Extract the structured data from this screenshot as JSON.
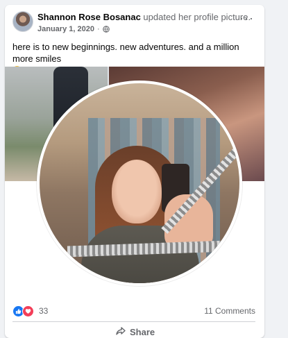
{
  "post": {
    "author": "Shannon Rose Bosanac",
    "action": " updated her profile picture.",
    "date": "January 1, 2020",
    "separator": "·",
    "text": "here is to new beginnings. new adventures. and a million more smiles",
    "more_label": "···",
    "privacy_icon": "globe-icon",
    "emoji_icon": "squinting-tongue-emoji-icon"
  },
  "reactions": {
    "icons": [
      "like-icon",
      "love-icon"
    ],
    "count": "33",
    "comments": "11 Comments"
  },
  "actions": {
    "share_label": "Share",
    "share_icon": "share-arrow-icon"
  },
  "colors": {
    "like": "#1877f2",
    "love": "#f33e58",
    "secondary_text": "#65676b"
  }
}
